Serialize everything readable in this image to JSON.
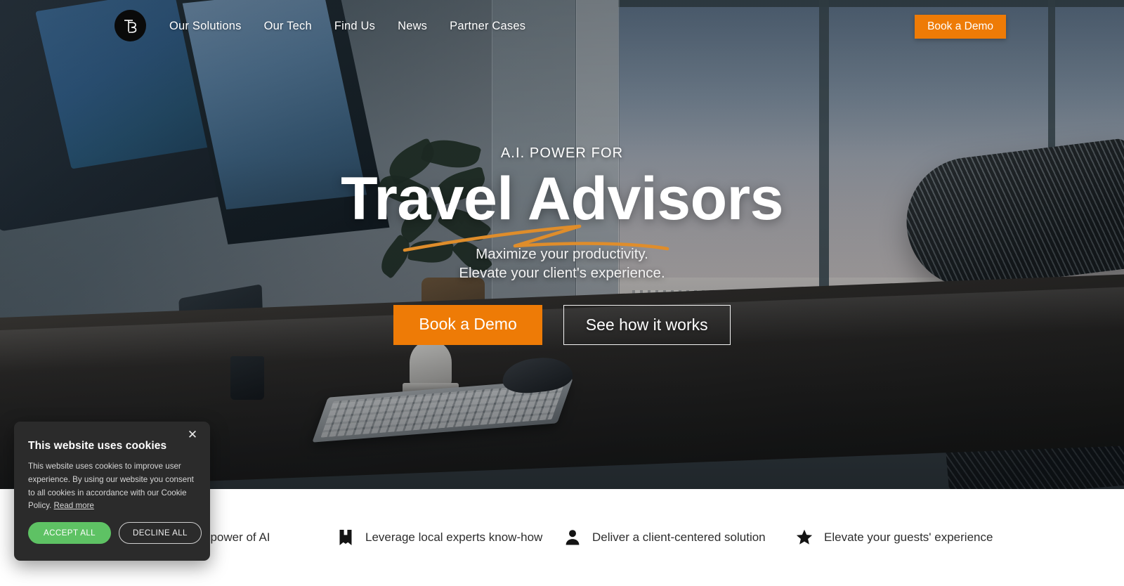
{
  "brand": {
    "logo_text": "TB",
    "logo_icon": "tb-monogram-logo"
  },
  "nav": {
    "links": [
      {
        "label": "Our Solutions"
      },
      {
        "label": "Our Tech"
      },
      {
        "label": "Find Us"
      },
      {
        "label": "News"
      },
      {
        "label": "Partner Cases"
      }
    ],
    "cta_label": "Book a Demo"
  },
  "hero": {
    "eyebrow": "A.I. POWER FOR",
    "headline": "Travel Advisors",
    "subtitle_line1": "Maximize your productivity.",
    "subtitle_line2": "Elevate your client's experience.",
    "primary_button": "Book a Demo",
    "secondary_button": "See how it works"
  },
  "features": [
    {
      "icon": "lightbulb-icon",
      "label": "Unleash the power of AI"
    },
    {
      "icon": "book-icon",
      "label": "Leverage local experts know-how"
    },
    {
      "icon": "person-icon",
      "label": "Deliver a client-centered solution"
    },
    {
      "icon": "star-icon",
      "label": "Elevate your guests' experience"
    }
  ],
  "cookie_banner": {
    "title": "This website uses cookies",
    "body": "This website uses cookies to improve user experience. By using our website you consent to all cookies in accordance with our Cookie Policy.",
    "read_more": "Read more",
    "accept_label": "ACCEPT ALL",
    "decline_label": "DECLINE ALL",
    "close_icon": "✕"
  },
  "colors": {
    "accent_orange": "#ee7b06",
    "accept_green": "#5ec264",
    "banner_bg": "#2b2b2b",
    "logo_bg": "#0a0a0a"
  }
}
